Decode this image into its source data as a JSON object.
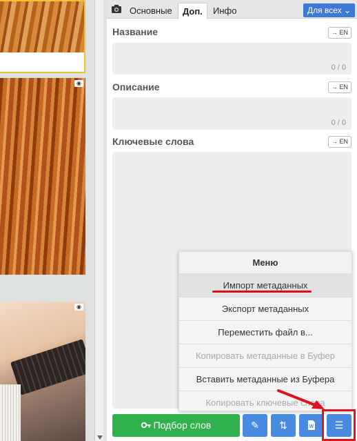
{
  "tabs": [
    {
      "label": "Основные"
    },
    {
      "label": "Доп."
    },
    {
      "label": "Инфо"
    }
  ],
  "scope_button": "Для всех",
  "fields": {
    "title": {
      "label": "Название",
      "lang": "→ EN",
      "counter": "0 / 0"
    },
    "description": {
      "label": "Описание",
      "lang": "→ EN",
      "counter": "0 / 0"
    },
    "keywords": {
      "label": "Ключевые слова",
      "lang": "→ EN"
    }
  },
  "menu": {
    "title": "Меню",
    "items": [
      {
        "label": "Импорт метаданных"
      },
      {
        "label": "Экспорт метаданных"
      },
      {
        "label": "Переместить файл в..."
      },
      {
        "label": "Копировать метаданные в Буфер"
      },
      {
        "label": "Вставить метаданные из Буфера"
      },
      {
        "label": "Копировать ключевые слова"
      }
    ]
  },
  "toolbar": {
    "keywords_button": "Подбор слов"
  },
  "colors": {
    "accent_blue": "#4a8be2",
    "green": "#2fb14b",
    "annotation_red": "#e0141e"
  }
}
